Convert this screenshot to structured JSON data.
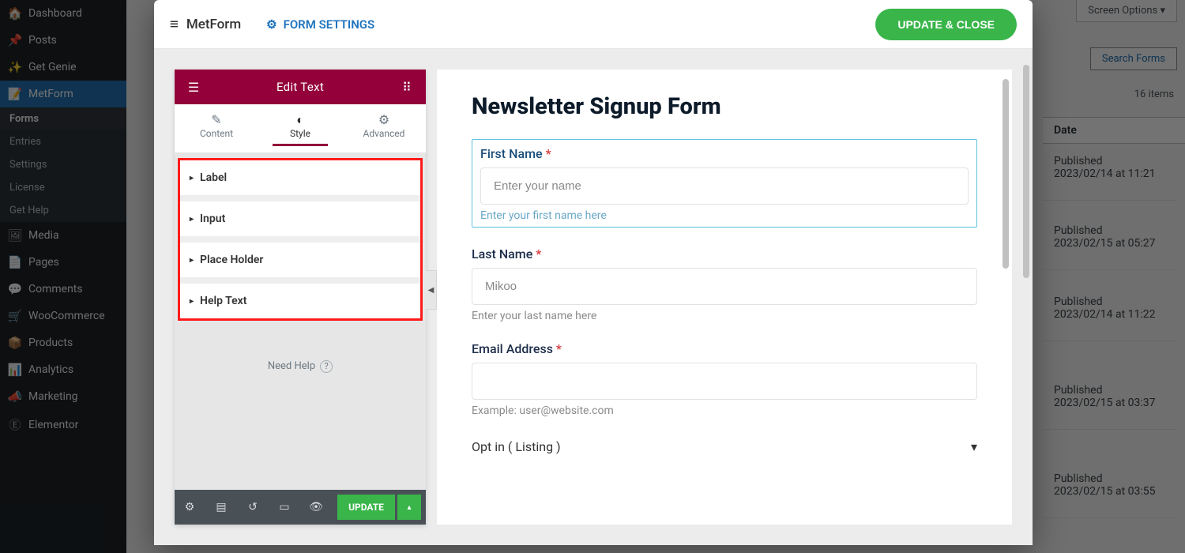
{
  "wp": {
    "items": [
      {
        "icon": "🏠",
        "label": "Dashboard"
      },
      {
        "icon": "📌",
        "label": "Posts"
      },
      {
        "icon": "✨",
        "label": "Get Genie"
      },
      {
        "icon": "📝",
        "label": "MetForm",
        "active": true
      },
      {
        "icon": "🖼",
        "label": "Media"
      },
      {
        "icon": "📄",
        "label": "Pages"
      },
      {
        "icon": "💬",
        "label": "Comments"
      },
      {
        "icon": "🛒",
        "label": "WooCommerce"
      },
      {
        "icon": "📦",
        "label": "Products"
      },
      {
        "icon": "📊",
        "label": "Analytics"
      },
      {
        "icon": "📣",
        "label": "Marketing"
      },
      {
        "icon": "Ⓔ",
        "label": "Elementor"
      }
    ],
    "sub": [
      "Forms",
      "Entries",
      "Settings",
      "License",
      "Get Help"
    ],
    "screen_options": "Screen Options  ▾",
    "search_forms": "Search Forms",
    "items_count": "16 items",
    "date_header": "Date",
    "rows": [
      {
        "status": "Published",
        "date": "2023/02/14 at 11:21"
      },
      {
        "status": "Published",
        "date": "2023/02/15 at 05:27"
      },
      {
        "status": "Published",
        "date": "2023/02/14 at 11:22"
      },
      {
        "status": "Published",
        "date": "2023/02/15 at 03:37"
      },
      {
        "status": "Published",
        "date": "2023/02/15 at 03:55"
      }
    ]
  },
  "modal": {
    "brand": "MetForm",
    "form_settings": "FORM SETTINGS",
    "update_close": "UPDATE & CLOSE"
  },
  "panel": {
    "title": "Edit Text",
    "tabs": {
      "content": "Content",
      "style": "Style",
      "advanced": "Advanced"
    },
    "accordion": [
      "Label",
      "Input",
      "Place Holder",
      "Help Text"
    ],
    "need_help": "Need Help",
    "update": "UPDATE"
  },
  "form": {
    "title": "Newsletter Signup Form",
    "first": {
      "label": "First Name",
      "placeholder": "Enter your name",
      "help": "Enter your first name here"
    },
    "last": {
      "label": "Last Name",
      "placeholder": "Mikoo",
      "help": "Enter your last name here"
    },
    "email": {
      "label": "Email Address",
      "help": "Example: user@website.com"
    },
    "optin": "Opt in ( Listing )",
    "req": "*"
  }
}
